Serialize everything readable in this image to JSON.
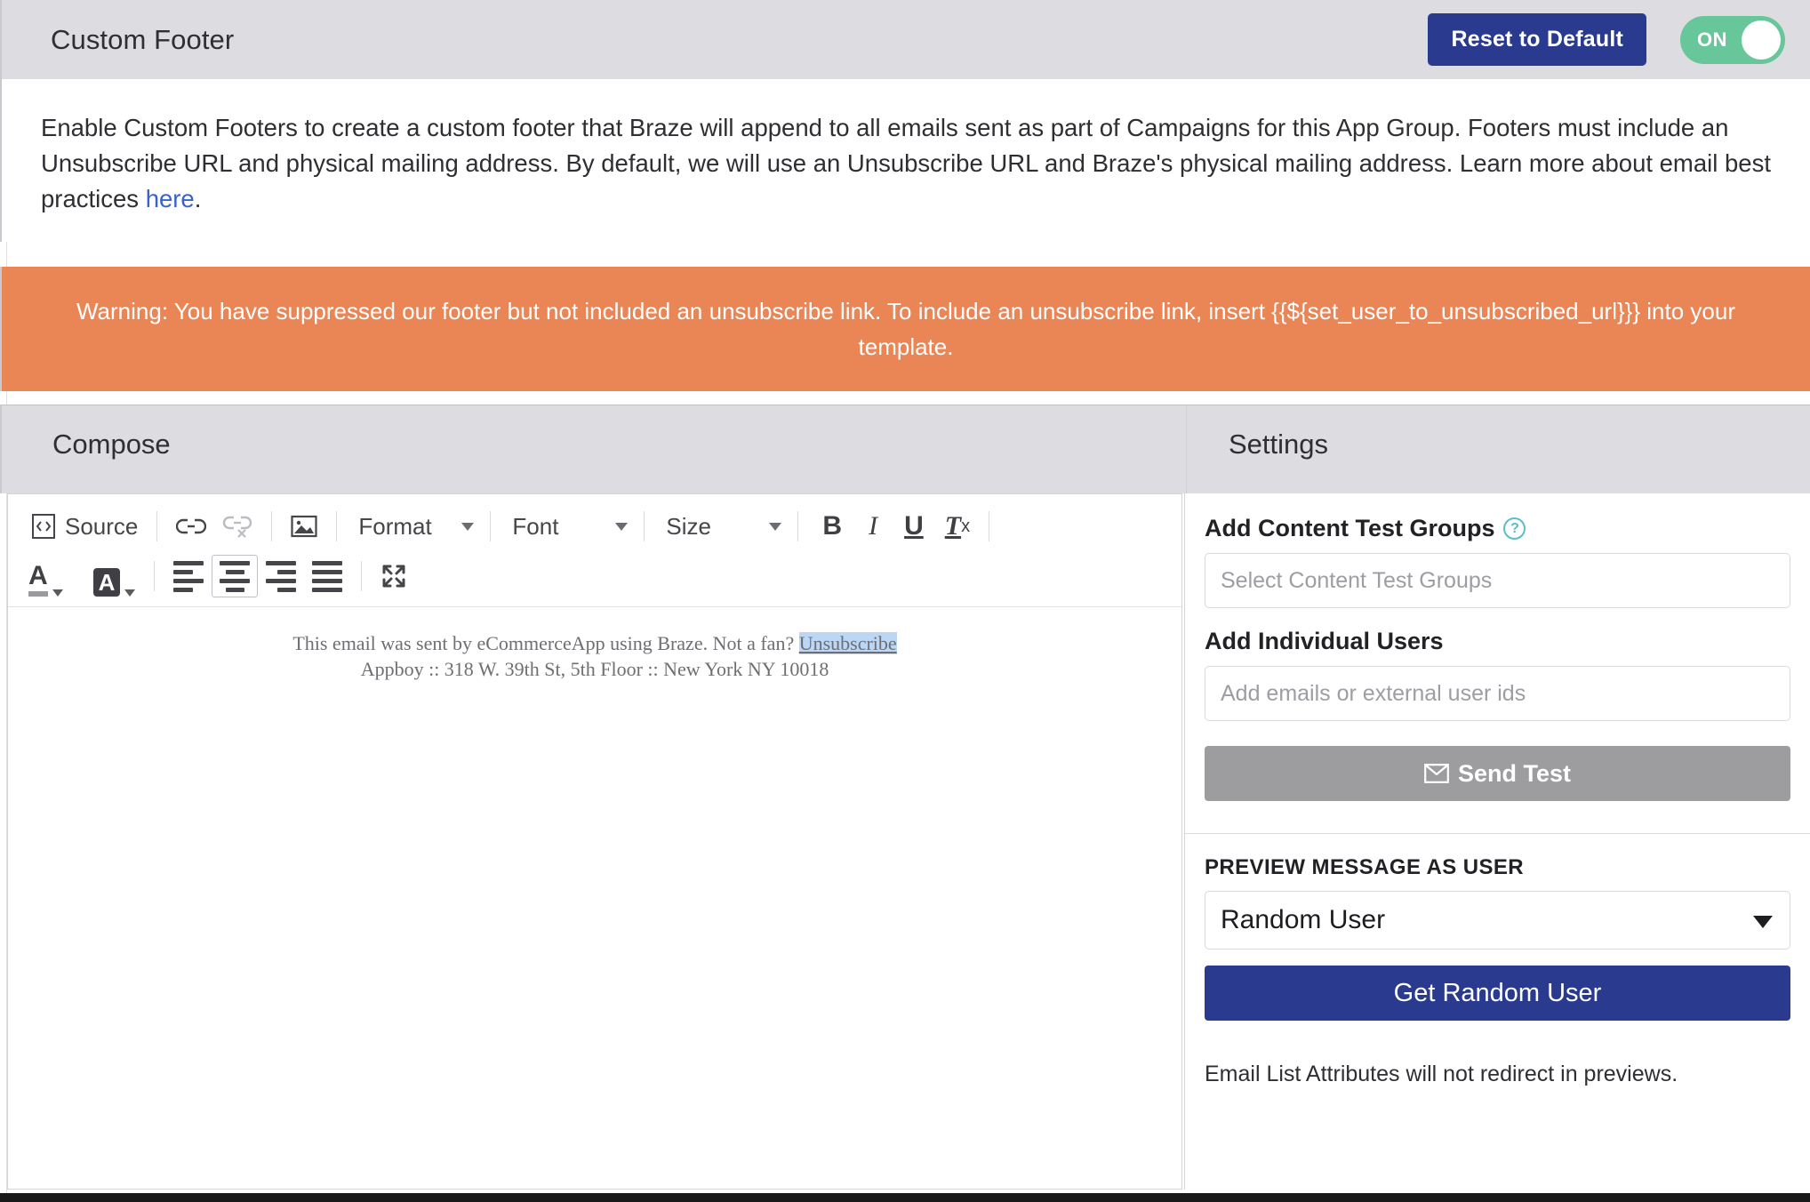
{
  "header": {
    "title": "Custom Footer",
    "reset_label": "Reset to Default",
    "toggle_label": "ON",
    "toggle_state": "on",
    "accent_blue": "#2a3b8f",
    "toggle_green": "#67c79a"
  },
  "description": {
    "part1": "Enable Custom Footers to create a custom footer that Braze will append to all emails sent as part of Campaigns for this App Group. Footers must include an Unsubscribe URL and physical mailing address. By default, we will use an Unsubscribe URL and Braze's physical mailing address. Learn more about email best practices ",
    "link": "here",
    "part2": "."
  },
  "warning": {
    "text": "Warning: You have suppressed our footer but not included an unsubscribe link. To include an unsubscribe link, insert {{${set_user_to_unsubscribed_url}}} into your template.",
    "background": "#ea8556"
  },
  "sections": {
    "compose_title": "Compose",
    "settings_title": "Settings"
  },
  "toolbar": {
    "source_label": "Source",
    "link_icon": "link-icon",
    "unlink_icon": "unlink-icon",
    "image_icon": "image-icon",
    "format_label": "Format",
    "font_label": "Font",
    "size_label": "Size",
    "bold_label": "B",
    "italic_label": "I",
    "underline_label": "U",
    "remove_format_label": "Tx",
    "text_color_label": "A",
    "bg_color_label": "A",
    "align_left": "align-left-icon",
    "align_center": "align-center-icon",
    "align_right": "align-right-icon",
    "align_justify": "align-justify-icon",
    "maximize": "maximize-icon",
    "active_alignment": "align-center"
  },
  "editor": {
    "line1_prefix": "This email was sent by eCommerceApp using Braze. Not a fan? ",
    "line1_link": "Unsubscribe",
    "line2": "Appboy :: 318 W. 39th St, 5th Floor :: New York NY 10018"
  },
  "settings": {
    "content_test_groups_label": "Add Content Test Groups",
    "content_test_groups_placeholder": "Select Content Test Groups",
    "content_test_groups_value": "",
    "individual_users_label": "Add Individual Users",
    "individual_users_placeholder": "Add emails or external user ids",
    "individual_users_value": "",
    "send_test_label": "Send Test",
    "send_test_enabled": "false",
    "preview_heading": "PREVIEW MESSAGE AS USER",
    "preview_selected": "Random User",
    "preview_options": [
      "Random User"
    ],
    "get_random_user_label": "Get Random User",
    "note": "Email List Attributes will not redirect in previews."
  }
}
